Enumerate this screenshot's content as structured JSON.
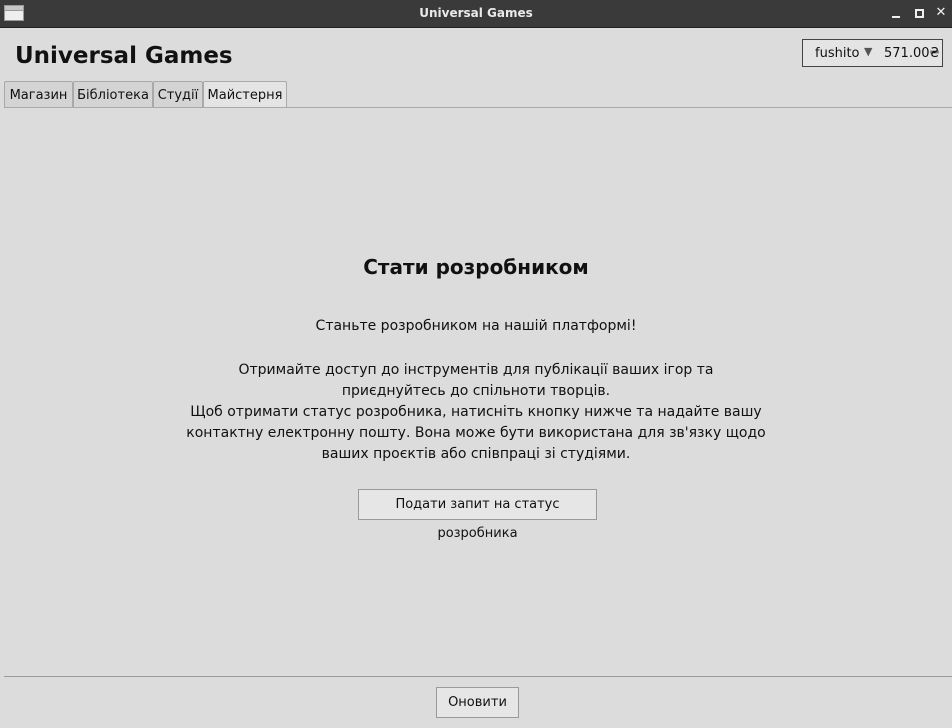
{
  "window": {
    "title": "Universal Games"
  },
  "header": {
    "app_title": "Universal Games",
    "account": {
      "username": "fushito",
      "balance": "571.00₴"
    }
  },
  "tabs": [
    {
      "label": "Магазин",
      "active": false
    },
    {
      "label": "Бібліотека",
      "active": false
    },
    {
      "label": "Студії",
      "active": false
    },
    {
      "label": "Майстерня",
      "active": true
    }
  ],
  "workshop": {
    "heading": "Стати розробником",
    "lead": "Станьте розробником на нашій платформі!",
    "description_lines": [
      "Отримайте доступ до інструментів для публікації ваших ігор та",
      "приєднуйтесь до спільноти творців.",
      "Щоб отримати статус розробника, натисніть кнопку нижче та надайте вашу",
      "контактну електронну пошту. Вона може бути використана для зв'язку щодо",
      "ваших проєктів або співпраці зі студіями."
    ],
    "request_button": "Подати запит на статус розробника"
  },
  "footer": {
    "refresh_button": "Оновити"
  }
}
